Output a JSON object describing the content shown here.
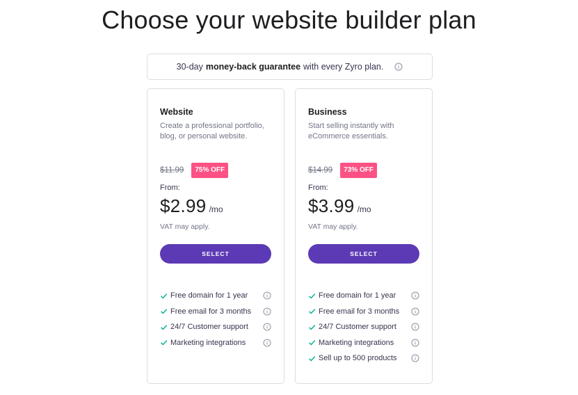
{
  "page": {
    "title": "Choose your website builder plan"
  },
  "guarantee": {
    "prefix": "30-day",
    "bold": "money-back guarantee",
    "suffix": "with every Zyro plan.",
    "icon": "info-icon"
  },
  "plans": [
    {
      "name": "Website",
      "description": "Create a professional portfolio, blog, or personal website.",
      "old_price": "$11.99",
      "discount": "75% OFF",
      "from_label": "From:",
      "price": "$2.99",
      "unit": "/mo",
      "vat": "VAT may apply.",
      "button": "SELECT",
      "features": [
        "Free domain for 1 year",
        "Free email for 3 months",
        "24/7 Customer support",
        "Marketing integrations"
      ]
    },
    {
      "name": "Business",
      "description": "Start selling instantly with eCommerce essentials.",
      "old_price": "$14.99",
      "discount": "73% OFF",
      "from_label": "From:",
      "price": "$3.99",
      "unit": "/mo",
      "vat": "VAT may apply.",
      "button": "SELECT",
      "features": [
        "Free domain for 1 year",
        "Free email for 3 months",
        "24/7 Customer support",
        "Marketing integrations",
        "Sell up to 500 products"
      ]
    }
  ],
  "colors": {
    "accent": "#5c3ab5",
    "discount_badge": "#fc5185",
    "check": "#00b090",
    "border": "#dadce0"
  }
}
